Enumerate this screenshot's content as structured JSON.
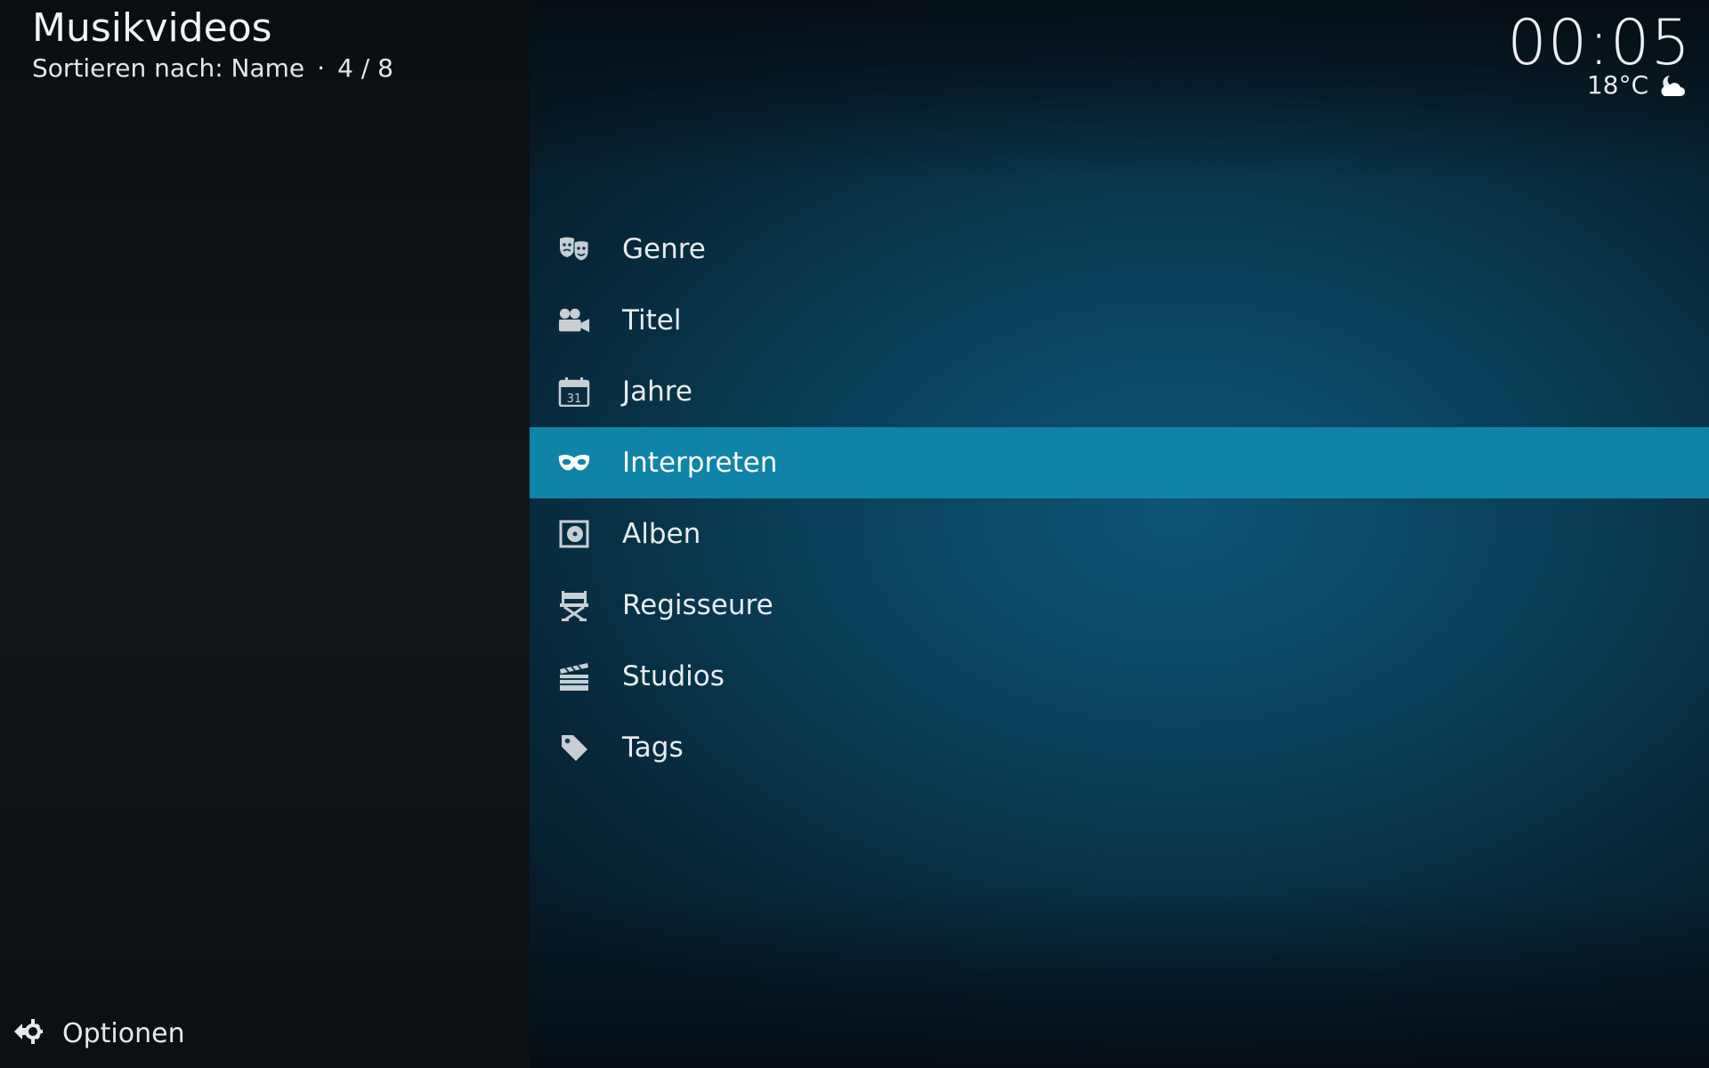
{
  "header": {
    "title": "Musikvideos",
    "sort_label": "Sortieren nach: Name",
    "separator": "·",
    "position": "4 / 8"
  },
  "clock": {
    "time": "00:05"
  },
  "weather": {
    "temperature": "18°C",
    "icon": "partly-cloudy-night-icon"
  },
  "menu": {
    "selected_index": 3,
    "items": [
      {
        "label": "Genre",
        "icon": "theater-masks-icon"
      },
      {
        "label": "Titel",
        "icon": "movie-camera-icon"
      },
      {
        "label": "Jahre",
        "icon": "calendar-icon",
        "icon_text": "31"
      },
      {
        "label": "Interpreten",
        "icon": "eye-mask-icon"
      },
      {
        "label": "Alben",
        "icon": "album-disc-icon"
      },
      {
        "label": "Regisseure",
        "icon": "director-chair-icon"
      },
      {
        "label": "Studios",
        "icon": "clapperboard-icon"
      },
      {
        "label": "Tags",
        "icon": "tag-icon"
      }
    ]
  },
  "footer": {
    "options_label": "Optionen",
    "options_icon": "gear-arrow-icon"
  },
  "colors": {
    "accent": "#0f84a8",
    "icon": "#c9ced2"
  }
}
